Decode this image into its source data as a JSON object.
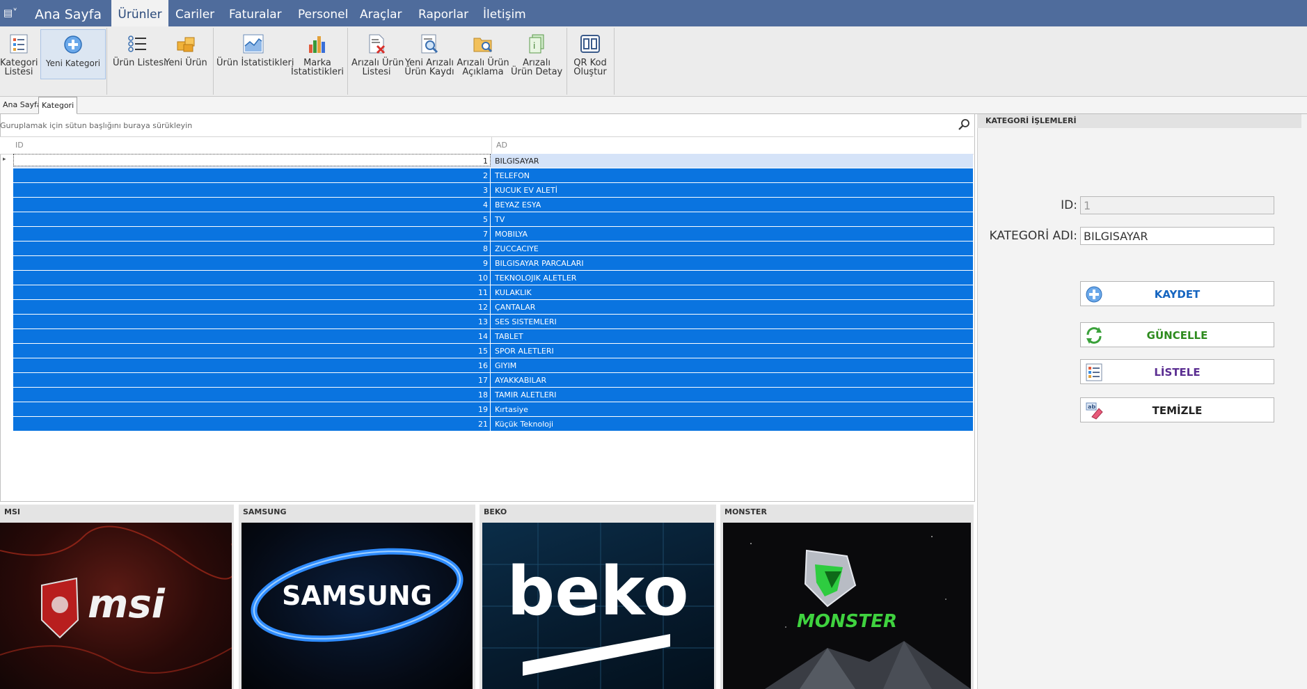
{
  "ribbon": {
    "tabs": [
      {
        "label": "Ana Sayfa"
      },
      {
        "label": "Ürünler"
      },
      {
        "label": "Cariler"
      },
      {
        "label": "Faturalar"
      },
      {
        "label": "Personel"
      },
      {
        "label": "Araçlar"
      },
      {
        "label": "Raporlar"
      },
      {
        "label": "İletişim"
      }
    ],
    "buttons": [
      {
        "line1": "Kategori",
        "line2": "Listesi"
      },
      {
        "line1": "Yeni Kategori",
        "line2": ""
      },
      {
        "line1": "Ürün Listesi",
        "line2": ""
      },
      {
        "line1": "Yeni Ürün",
        "line2": ""
      },
      {
        "line1": "Ürün İstatistikleri",
        "line2": ""
      },
      {
        "line1": "Marka",
        "line2": "İstatistikleri"
      },
      {
        "line1": "Arızalı Ürün",
        "line2": "Listesi"
      },
      {
        "line1": "Yeni Arızalı",
        "line2": "Ürün Kaydı"
      },
      {
        "line1": "Arızalı Ürün",
        "line2": "Açıklama"
      },
      {
        "line1": "Arızalı",
        "line2": "Ürün Detay"
      },
      {
        "line1": "QR Kod",
        "line2": "Oluştur"
      }
    ]
  },
  "doc_tabs": [
    "Ana Sayfa",
    "Kategori"
  ],
  "grid": {
    "group_hint": "Guruplamak için sütun başlığını buraya sürükleyin",
    "columns": [
      "ID",
      "AD"
    ],
    "rows": [
      {
        "id": "1",
        "ad": "BILGISAYAR"
      },
      {
        "id": "2",
        "ad": "TELEFON"
      },
      {
        "id": "3",
        "ad": "KUCUK EV ALETİ"
      },
      {
        "id": "4",
        "ad": "BEYAZ ESYA"
      },
      {
        "id": "5",
        "ad": "TV"
      },
      {
        "id": "7",
        "ad": "MOBILYA"
      },
      {
        "id": "8",
        "ad": "ZUCCACIYE"
      },
      {
        "id": "9",
        "ad": "BILGISAYAR PARCALARI"
      },
      {
        "id": "10",
        "ad": "TEKNOLOJIK ALETLER"
      },
      {
        "id": "11",
        "ad": "KULAKLIK"
      },
      {
        "id": "12",
        "ad": "ÇANTALAR"
      },
      {
        "id": "13",
        "ad": "SES SISTEMLERI"
      },
      {
        "id": "14",
        "ad": "TABLET"
      },
      {
        "id": "15",
        "ad": "SPOR ALETLERI"
      },
      {
        "id": "16",
        "ad": "GIYIM"
      },
      {
        "id": "17",
        "ad": "AYAKKABILAR"
      },
      {
        "id": "18",
        "ad": "TAMIR ALETLERI"
      },
      {
        "id": "19",
        "ad": "Kırtasiye"
      },
      {
        "id": "21",
        "ad": "Küçük Teknoloji"
      }
    ]
  },
  "panel": {
    "title": "KATEGORİ İŞLEMLERİ",
    "id_label": "ID:",
    "id_value": "1",
    "name_label": "KATEGORİ ADI:",
    "name_value": "BILGISAYAR",
    "buttons": {
      "save": "KAYDET",
      "update": "GÜNCELLE",
      "list": "LİSTELE",
      "clear": "TEMİZLE"
    }
  },
  "brands": [
    {
      "title": "MSI",
      "logo": "msi"
    },
    {
      "title": "SAMSUNG",
      "logo": "SAMSUNG"
    },
    {
      "title": "BEKO",
      "logo": "beko"
    },
    {
      "title": "MONSTER",
      "logo": "MONSTER"
    }
  ],
  "colors": {
    "accent": "#4f6c9c",
    "selection": "#0a74e0",
    "save": "#1565c0",
    "update": "#2e8b1e",
    "list": "#5a2d91",
    "clear": "#222222"
  }
}
